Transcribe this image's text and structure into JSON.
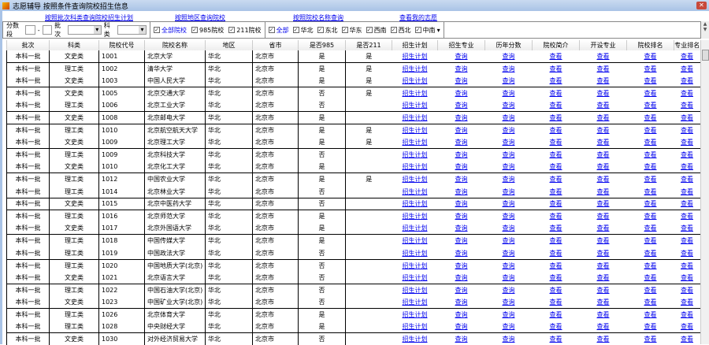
{
  "window": {
    "title": "志愿辅导  按照条件查询院校招生信息"
  },
  "links": [
    "按照批次科类查询院校招生计划",
    "按照地区查询院校",
    "按照院校名称查询",
    "查看我的志愿"
  ],
  "toolbar": {
    "score_label": "分数段",
    "dash": "-",
    "batch_label": "批次",
    "type_label": "科类",
    "checks": [
      {
        "label": "全部院校",
        "checked": true
      },
      {
        "label": "985院校",
        "checked": true
      },
      {
        "label": "211院校",
        "checked": true
      }
    ],
    "regions": [
      {
        "label": "全部",
        "checked": true
      },
      {
        "label": "华北",
        "checked": true
      },
      {
        "label": "东北",
        "checked": true
      },
      {
        "label": "华东",
        "checked": true
      },
      {
        "label": "西南",
        "checked": true
      },
      {
        "label": "西北",
        "checked": true
      },
      {
        "label": "中南",
        "checked": true
      }
    ]
  },
  "columns": [
    "批次",
    "科类",
    "院校代号",
    "院校名称",
    "地区",
    "省市",
    "是否985",
    "是否211",
    "招生计划",
    "招生专业",
    "历年分数",
    "院校简介",
    "开设专业",
    "院校排名",
    "专业排名"
  ],
  "link_labels": [
    "招生计划",
    "查询",
    "查询",
    "查看",
    "查看",
    "查看",
    "查看"
  ],
  "rows": [
    [
      "本科一批",
      "文史类",
      "1001",
      "北京大学",
      "华北",
      "北京市",
      "是",
      "是"
    ],
    [
      "本科一批",
      "理工类",
      "1002",
      "清华大学",
      "华北",
      "北京市",
      "是",
      "是"
    ],
    [
      "本科一批",
      "文史类",
      "1003",
      "中国人民大学",
      "华北",
      "北京市",
      "是",
      "是"
    ],
    [
      "本科一批",
      "文史类",
      "1005",
      "北京交通大学",
      "华北",
      "北京市",
      "否",
      "是"
    ],
    [
      "本科一批",
      "理工类",
      "1006",
      "北京工业大学",
      "华北",
      "北京市",
      "否",
      ""
    ],
    [
      "本科一批",
      "文史类",
      "1008",
      "北京邮电大学",
      "华北",
      "北京市",
      "是",
      ""
    ],
    [
      "本科一批",
      "理工类",
      "1010",
      "北京航空航天大学",
      "华北",
      "北京市",
      "是",
      "是"
    ],
    [
      "本科一批",
      "文史类",
      "1009",
      "北京理工大学",
      "华北",
      "北京市",
      "是",
      "是"
    ],
    [
      "本科一批",
      "理工类",
      "1009",
      "北京科技大学",
      "华北",
      "北京市",
      "否",
      ""
    ],
    [
      "本科一批",
      "文史类",
      "1010",
      "北京化工大学",
      "华北",
      "北京市",
      "是",
      ""
    ],
    [
      "本科一批",
      "理工类",
      "1012",
      "中国农业大学",
      "华北",
      "北京市",
      "是",
      "是"
    ],
    [
      "本科一批",
      "理工类",
      "1014",
      "北京林业大学",
      "华北",
      "北京市",
      "否",
      ""
    ],
    [
      "本科一批",
      "文史类",
      "1015",
      "北京中医药大学",
      "华北",
      "北京市",
      "否",
      ""
    ],
    [
      "本科一批",
      "理工类",
      "1016",
      "北京师范大学",
      "华北",
      "北京市",
      "是",
      ""
    ],
    [
      "本科一批",
      "文史类",
      "1017",
      "北京外国语大学",
      "华北",
      "北京市",
      "是",
      ""
    ],
    [
      "本科一批",
      "理工类",
      "1018",
      "中国传媒大学",
      "华北",
      "北京市",
      "是",
      ""
    ],
    [
      "本科一批",
      "理工类",
      "1019",
      "中国政法大学",
      "华北",
      "北京市",
      "否",
      ""
    ],
    [
      "本科一批",
      "理工类",
      "1020",
      "中国地质大学(北京)",
      "华北",
      "北京市",
      "否",
      ""
    ],
    [
      "本科一批",
      "文史类",
      "1021",
      "北京语言大学",
      "华北",
      "北京市",
      "否",
      ""
    ],
    [
      "本科一批",
      "理工类",
      "1022",
      "中国石油大学(北京)",
      "华北",
      "北京市",
      "否",
      ""
    ],
    [
      "本科一批",
      "文史类",
      "1023",
      "中国矿业大学(北京)",
      "华北",
      "北京市",
      "否",
      ""
    ],
    [
      "本科一批",
      "理工类",
      "1026",
      "北京体育大学",
      "华北",
      "北京市",
      "是",
      ""
    ],
    [
      "本科一批",
      "理工类",
      "1028",
      "中央财经大学",
      "华北",
      "北京市",
      "是",
      ""
    ],
    [
      "本科一批",
      "文史类",
      "1030",
      "对外经济贸易大学",
      "华北",
      "北京市",
      "否",
      ""
    ]
  ],
  "group_ends": [
    0,
    2,
    4,
    5,
    7,
    9,
    11,
    12,
    14,
    16,
    18,
    20,
    22
  ]
}
